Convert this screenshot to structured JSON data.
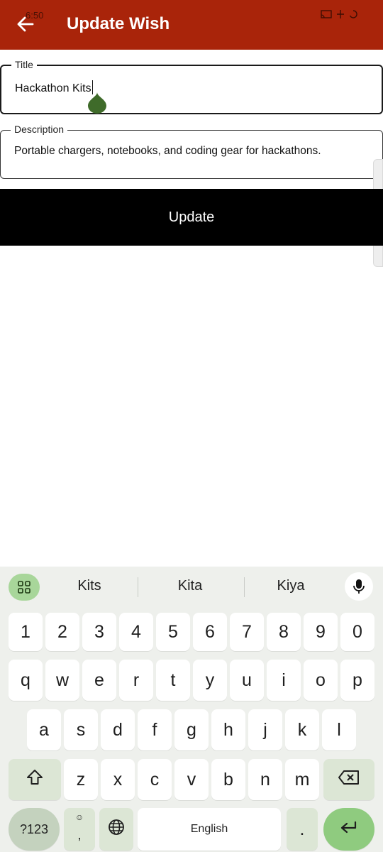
{
  "status": {
    "time": "6:50"
  },
  "appbar": {
    "title": "Update Wish",
    "bg": "#A9240A"
  },
  "form": {
    "title_label": "Title",
    "title_value": "Hackathon Kits",
    "description_label": "Description",
    "description_value": "Portable chargers, notebooks, and coding gear for hackathons.",
    "update_label": "Update"
  },
  "keyboard": {
    "suggestions": [
      "Kits",
      "Kita",
      "Kiya"
    ],
    "row_numbers": [
      "1",
      "2",
      "3",
      "4",
      "5",
      "6",
      "7",
      "8",
      "9",
      "0"
    ],
    "row_1": [
      "q",
      "w",
      "e",
      "r",
      "t",
      "y",
      "u",
      "i",
      "o",
      "p"
    ],
    "row_2": [
      "a",
      "s",
      "d",
      "f",
      "g",
      "h",
      "j",
      "k",
      "l"
    ],
    "row_3": [
      "z",
      "x",
      "c",
      "v",
      "b",
      "n",
      "m"
    ],
    "symbols_label": "?123",
    "comma_label": ",",
    "space_label": "English",
    "period_label": "."
  }
}
